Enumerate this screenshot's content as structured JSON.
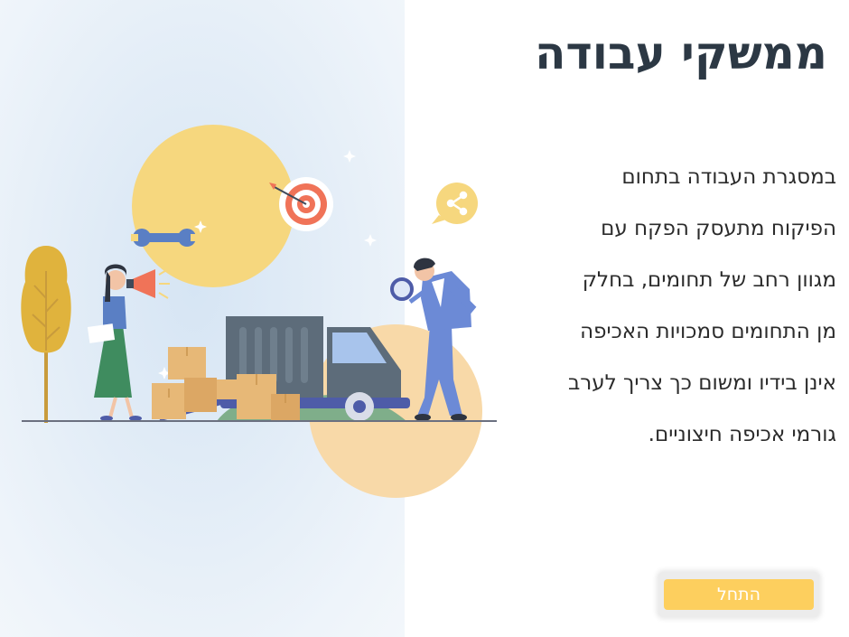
{
  "slide": {
    "title": "ממשקי עבודה",
    "body_lines": [
      "במסגרת העבודה בתחום",
      "הפיקוח מתעסק הפקח עם",
      "מגוון רחב של תחומים, בחלק",
      "מן התחומים סמכויות האכיפה",
      "אינן בידיו ומשום כך צריך לערב",
      "גורמי אכיפה חיצוניים."
    ],
    "start_button_label": "התחל"
  },
  "illustration": {
    "icons": [
      "tree-icon",
      "wrench-icon",
      "target-icon",
      "share-icon",
      "megaphone-icon",
      "magnifier-icon",
      "truck-icon",
      "boxes-icon"
    ]
  },
  "colors": {
    "title": "#2c3844",
    "body_text": "#2b2b2b",
    "button": "#fdcf5e",
    "button_text": "#ffffff",
    "panel_background": "#e3edf7",
    "yellow_circle": "#f6d77e",
    "peach_circle": "#f8d9a8"
  }
}
